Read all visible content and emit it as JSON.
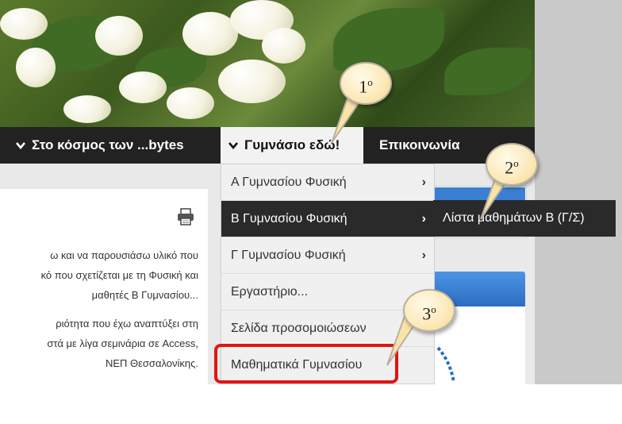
{
  "nav": {
    "items": [
      {
        "label": "Στο κόσμος των ...bytes"
      },
      {
        "label": "Γυμνάσιο εδώ!"
      },
      {
        "label": "Επικοινωνία"
      }
    ]
  },
  "dropdown": {
    "items": [
      {
        "label": "Α Γυμνασίου Φυσική"
      },
      {
        "label": "Β Γυμνασίου Φυσική"
      },
      {
        "label": "Γ Γυμνασίου Φυσική"
      },
      {
        "label": "Εργαστήριο..."
      },
      {
        "label": "Σελίδα προσομοιώσεων"
      },
      {
        "label": "Μαθηματικά Γυμνασίου"
      }
    ],
    "arrow_glyph": "›"
  },
  "submenu": {
    "label": "Λίστα μαθημάτων Β (Γ/Σ)"
  },
  "content": {
    "lines": [
      "ω και να παρουσιάσω υλικό που",
      "κό που σχετίζεται με τη Φυσική και",
      "μαθητές Β Γυμνασίου...",
      "ριότητα που έχω αναπτύξει στη",
      "στά με λίγα σεμινάρια σε Access,",
      "ΝΕΠ Θεσσαλονίκης."
    ]
  },
  "callouts": [
    {
      "number": "1",
      "suffix": "o"
    },
    {
      "number": "2",
      "suffix": "o"
    },
    {
      "number": "3",
      "suffix": "o"
    }
  ],
  "colors": {
    "navbar": "#222222",
    "highlight": "#e01414",
    "sidebar_blue": "#3a7fd1"
  },
  "icons": {
    "chevron": "chevron-down-icon",
    "printer": "printer-icon"
  }
}
